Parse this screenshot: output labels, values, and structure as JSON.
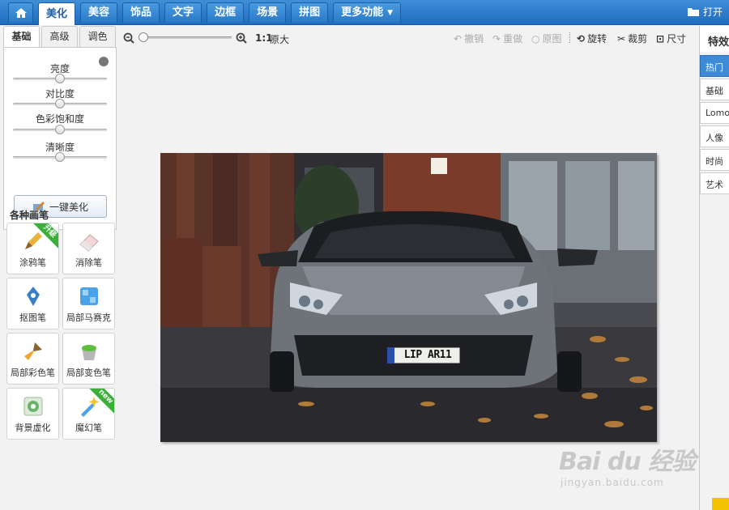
{
  "top_tabs": [
    {
      "label": "美化",
      "active": true
    },
    {
      "label": "美容"
    },
    {
      "label": "饰品"
    },
    {
      "label": "文字"
    },
    {
      "label": "边框"
    },
    {
      "label": "场景"
    },
    {
      "label": "拼图"
    },
    {
      "label": "更多功能",
      "dropdown": true
    }
  ],
  "open_label": "打开",
  "left_panel": {
    "subtabs": [
      "基础",
      "高级",
      "调色"
    ],
    "sliders": [
      {
        "label": "亮度",
        "value": 0.5
      },
      {
        "label": "对比度",
        "value": 0.5
      },
      {
        "label": "色彩饱和度",
        "value": 0.5
      },
      {
        "label": "清晰度",
        "value": 0.5
      }
    ],
    "auto_button": "一键美化",
    "brushes_title": "各种画笔",
    "brushes": [
      {
        "label": "涂鸦笔",
        "badge": "升级"
      },
      {
        "label": "消除笔"
      },
      {
        "label": "抠图笔"
      },
      {
        "label": "局部马赛克"
      },
      {
        "label": "局部彩色笔"
      },
      {
        "label": "局部变色笔"
      },
      {
        "label": "背景虚化"
      },
      {
        "label": "魔幻笔",
        "badge": "new"
      }
    ]
  },
  "toolbar": {
    "zoom_ratio": "1:1",
    "zoom_original": "原大",
    "undo": "撤销",
    "redo": "重做",
    "original": "原图",
    "rotate": "旋转",
    "crop": "裁剪",
    "size": "尺寸"
  },
  "photo": {
    "license_plate": "LIP AR11"
  },
  "right_panel": {
    "title": "特效",
    "items": [
      "热门",
      "基础",
      "Lomo",
      "人像",
      "时尚",
      "艺术"
    ],
    "active": "热门"
  },
  "watermark": {
    "brand": "Bai du 经验",
    "url": "jingyan.baidu.com"
  },
  "colors": {
    "accent": "#2a78c8",
    "ribbon": "#3ab03a"
  }
}
